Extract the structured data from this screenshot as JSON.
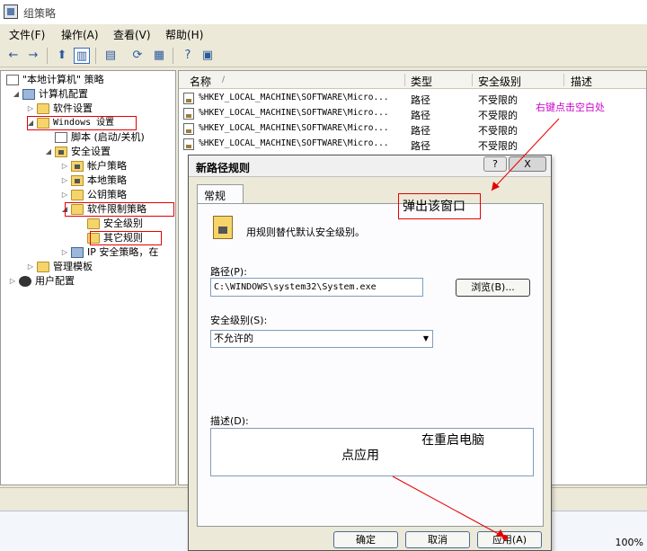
{
  "window": {
    "title": "组策略"
  },
  "menu": [
    "文件(F)",
    "操作(A)",
    "查看(V)",
    "帮助(H)"
  ],
  "tree": {
    "nodes": [
      {
        "label": "\"本地计算机\" 策略"
      },
      {
        "label": "计算机配置"
      },
      {
        "label": "软件设置"
      },
      {
        "label": "Windows 设置"
      },
      {
        "label": "脚本 (启动/关机)"
      },
      {
        "label": "安全设置"
      },
      {
        "label": "帐户策略"
      },
      {
        "label": "本地策略"
      },
      {
        "label": "公钥策略"
      },
      {
        "label": "软件限制策略"
      },
      {
        "label": "安全级别"
      },
      {
        "label": "其它规则"
      },
      {
        "label": "IP 安全策略，在"
      },
      {
        "label": "管理模板"
      },
      {
        "label": "用户配置"
      }
    ]
  },
  "list": {
    "columns": [
      "名称",
      "类型",
      "安全级别",
      "描述"
    ],
    "rows": [
      {
        "name": "%HKEY_LOCAL_MACHINE\\SOFTWARE\\Micro...",
        "type": "路径",
        "level": "不受限的"
      },
      {
        "name": "%HKEY_LOCAL_MACHINE\\SOFTWARE\\Micro...",
        "type": "路径",
        "level": "不受限的"
      },
      {
        "name": "%HKEY_LOCAL_MACHINE\\SOFTWARE\\Micro...",
        "type": "路径",
        "level": "不受限的"
      },
      {
        "name": "%HKEY_LOCAL_MACHINE\\SOFTWARE\\Micro...",
        "type": "路径",
        "level": "不受限的"
      }
    ]
  },
  "annotations": {
    "right_click": "右键点击空白处",
    "popup": "弹出该窗口",
    "click_apply": "点应用",
    "restart": "在重启电脑"
  },
  "dialog": {
    "title": "新路径规则",
    "help_btn": "?",
    "close_btn": "X",
    "tab": "常规",
    "intro": "用规则替代默认安全级别。",
    "path_label": "路径(P):",
    "path_value": "C:\\WINDOWS\\system32\\System.exe",
    "browse_label": "浏览(B)...",
    "level_label": "安全级别(S):",
    "level_value": "不允许的",
    "desc_label": "描述(D):",
    "ok": "确定",
    "cancel": "取消",
    "apply": "应用(A)"
  },
  "status": {
    "zoom": "100%"
  },
  "colors": {
    "annotation": "#cc00cc",
    "highlight_box": "#e60000",
    "selection": "#316ac5"
  },
  "icons": [
    "back-icon",
    "forward-icon",
    "up-folder-icon",
    "show-tree-icon",
    "export-icon",
    "refresh-icon",
    "export-list-icon",
    "help-icon",
    "properties-icon"
  ]
}
